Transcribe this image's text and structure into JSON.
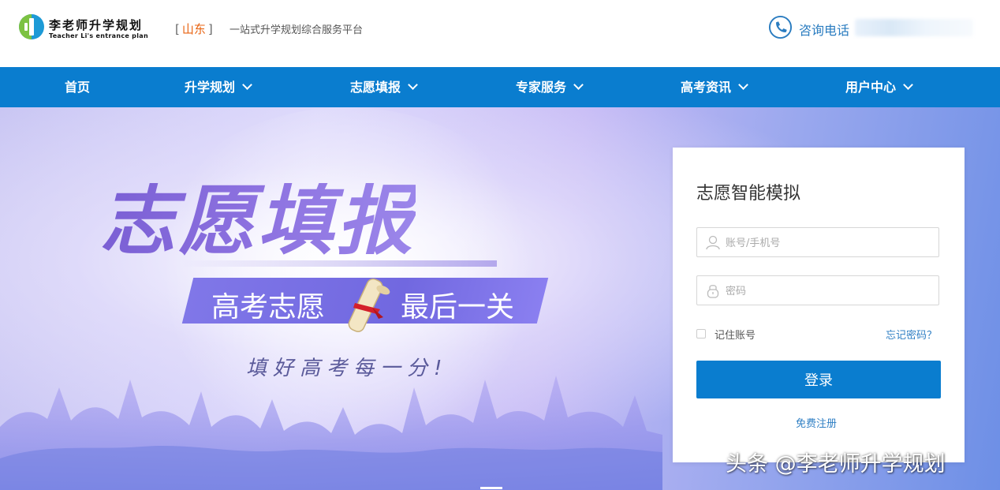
{
  "header": {
    "logo_title": "李老师升学规划",
    "logo_subtitle": "Teacher Li's entrance plan",
    "region_open": "[",
    "region_city": "山东",
    "region_close": "]",
    "tagline": "一站式升学规划综合服务平台",
    "phone_label": "咨询电话"
  },
  "nav": {
    "items": [
      {
        "label": "首页"
      },
      {
        "label": "升学规划"
      },
      {
        "label": "志愿填报"
      },
      {
        "label": "专家服务"
      },
      {
        "label": "高考资讯"
      },
      {
        "label": "用户中心"
      }
    ]
  },
  "banner": {
    "title": "志愿填报",
    "band_left": "高考志愿",
    "band_right": "最后一关",
    "slogan": "填好高考每一分!"
  },
  "login": {
    "title": "志愿智能模拟",
    "account_placeholder": "账号/手机号",
    "password_placeholder": "密码",
    "remember_label": "记住账号",
    "forgot_label": "忘记密码？",
    "submit_label": "登录",
    "register_label": "免费注册"
  },
  "watermark": "头条 @李老师升学规划",
  "colors": {
    "nav_bg": "#0a7dcf",
    "accent": "#e8620f",
    "link": "#2f7fc4"
  },
  "icons": [
    "logo-mark-icon",
    "phone-icon",
    "chevron-down-icon",
    "user-icon",
    "lock-icon",
    "diploma-scroll-icon"
  ]
}
